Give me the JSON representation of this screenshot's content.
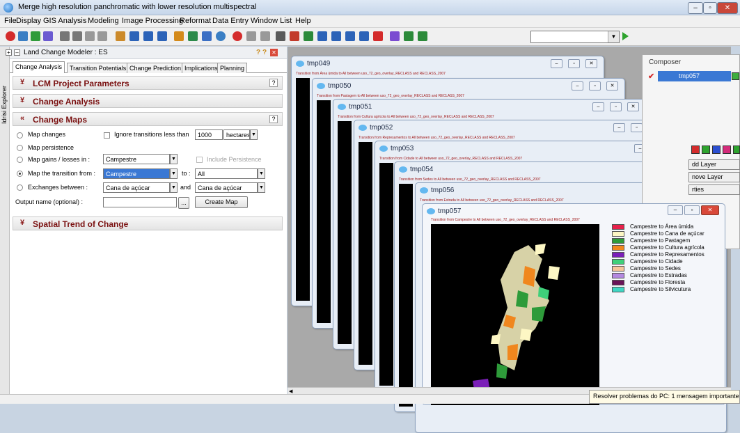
{
  "title_bar": {
    "title": "Merge high resolution panchromatic with lower resolution multispectral"
  },
  "menu": [
    "File",
    "Display",
    "GIS Analysis",
    "Modeling",
    "Image Processing",
    "Reformat",
    "Data Entry",
    "Window List",
    "Help"
  ],
  "left_sidebar": {
    "label": "Idrisi Explorer"
  },
  "lcm": {
    "title": "Land Change Modeler : ES",
    "tabs": [
      "Change Analysis",
      "Transition Potentials",
      "Change Prediction",
      "Implications",
      "Planning"
    ],
    "sections": {
      "project": "LCM Project Parameters",
      "analysis": "Change Analysis",
      "maps": "Change Maps",
      "trend": "Spatial Trend of Change"
    },
    "help": "?",
    "options": {
      "map_changes": "Map changes",
      "ignore": "Ignore transitions less than",
      "ignore_value": "1000",
      "ignore_unit": "hectares",
      "persistence": "Map persistence",
      "gains": "Map gains / losses in :",
      "gains_value": "Campestre",
      "include_persistence": "Include Persistence",
      "transition": "Map the transition from :",
      "transition_from": "Campestre",
      "to_label": "to :",
      "to_value": "All",
      "exchanges": "Exchanges between :",
      "ex_a": "Cana de açúcar",
      "and_label": "and",
      "ex_b": "Cana de açúcar",
      "output": "Output name (optional) :",
      "output_value": "",
      "browse": "...",
      "create": "Create Map"
    }
  },
  "windows": [
    {
      "title": "tmp049",
      "subtitle": "Transition from Área úmida to All between uso_72_geo_overlay_RECLASS and RECLASS_2007"
    },
    {
      "title": "tmp050",
      "subtitle": "Transition from Pastagem to All between uso_72_geo_overlay_RECLASS and RECLASS_2007"
    },
    {
      "title": "tmp051",
      "subtitle": "Transition from Cultura agrícola to All between uso_72_geo_overlay_RECLASS and RECLASS_2007"
    },
    {
      "title": "tmp052",
      "subtitle": "Transition from Represamentos to All between uso_72_geo_overlay_RECLASS and RECLASS_2007"
    },
    {
      "title": "tmp053",
      "subtitle": "Transition from Cidade to All between uso_72_geo_overlay_RECLASS and RECLASS_2007"
    },
    {
      "title": "tmp054",
      "subtitle": "Transition from Sedes to All between uso_72_geo_overlay_RECLASS and RECLASS_2007"
    },
    {
      "title": "tmp056",
      "subtitle": "Transition from Estrada to All between uso_72_geo_overlay_RECLASS and RECLASS_2007"
    }
  ],
  "front": {
    "title": "tmp057",
    "subtitle": "Transition from Campestre to All between uso_72_geo_overlay_RECLASS and RECLASS_2007",
    "legend": [
      {
        "label": "Campestre to Área úmida",
        "color": "#e8204a"
      },
      {
        "label": "Campestre to Cana de açúcar",
        "color": "#fdf7c4"
      },
      {
        "label": "Campestre to Pastagem",
        "color": "#2e9b3a"
      },
      {
        "label": "Campestre to Cultura agrícola",
        "color": "#f0871e"
      },
      {
        "label": "Campestre to Represamentos",
        "color": "#7a1fb8"
      },
      {
        "label": "Campestre to Cidade",
        "color": "#3fd07a"
      },
      {
        "label": "Campestre to Sedes",
        "color": "#f5c59b"
      },
      {
        "label": "Campestre to Estradas",
        "color": "#b388e0"
      },
      {
        "label": "Campestre to Floresta",
        "color": "#6a1458"
      },
      {
        "label": "Campestre to Silvicutura",
        "color": "#3fd7c4"
      }
    ]
  },
  "composer": {
    "title": "Composer",
    "selected": "tmp057",
    "buttons": [
      "dd Layer",
      "nove Layer",
      "rties"
    ]
  },
  "notification": "Resolver problemas do PC: 1 mensagem importante"
}
